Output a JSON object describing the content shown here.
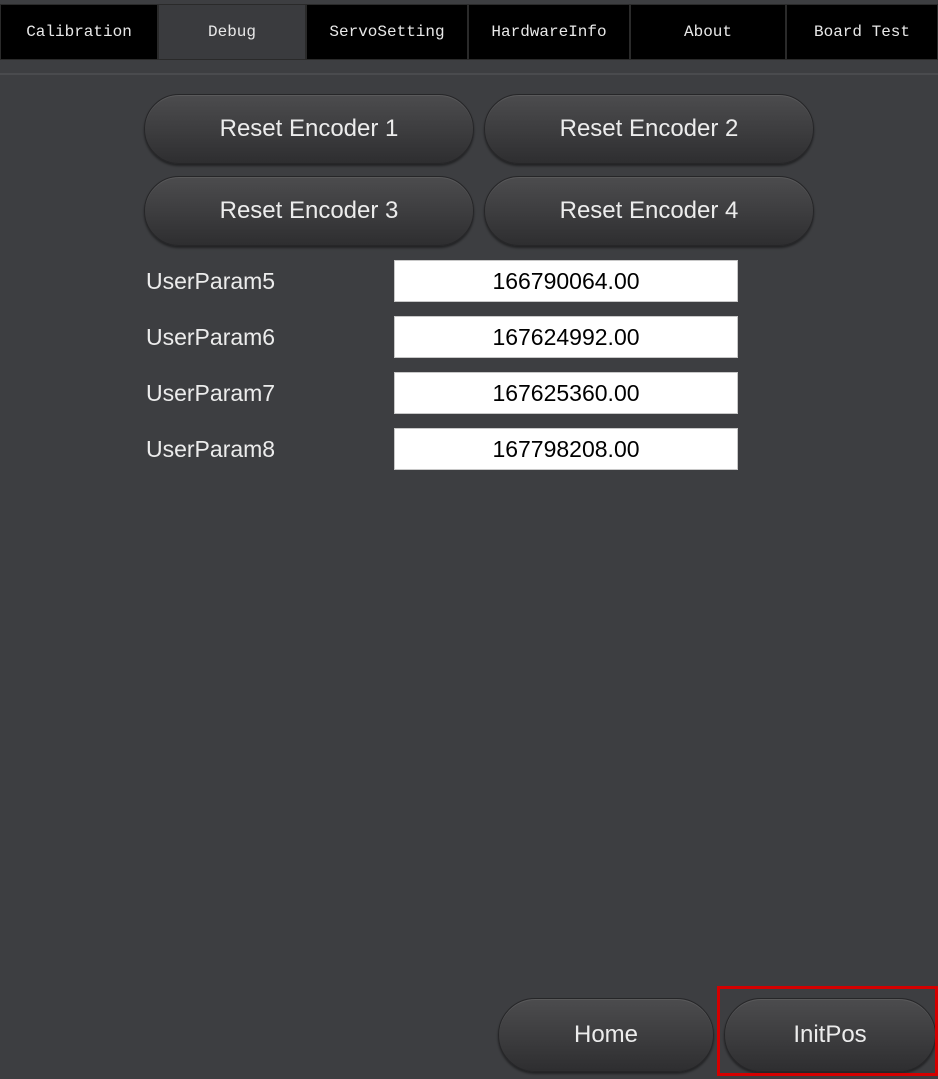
{
  "tabs": [
    {
      "label": "Calibration",
      "active": false
    },
    {
      "label": "Debug",
      "active": true
    },
    {
      "label": "ServoSetting",
      "active": false
    },
    {
      "label": "HardwareInfo",
      "active": false
    },
    {
      "label": "About",
      "active": false
    },
    {
      "label": "Board Test",
      "active": false
    }
  ],
  "encoders": {
    "reset1": "Reset Encoder 1",
    "reset2": "Reset Encoder 2",
    "reset3": "Reset Encoder 3",
    "reset4": "Reset Encoder 4"
  },
  "params": [
    {
      "label": "UserParam5",
      "value": "166790064.00"
    },
    {
      "label": "UserParam6",
      "value": "167624992.00"
    },
    {
      "label": "UserParam7",
      "value": "167625360.00"
    },
    {
      "label": "UserParam8",
      "value": "167798208.00"
    }
  ],
  "footer": {
    "home_label": "Home",
    "initpos_label": "InitPos"
  },
  "colors": {
    "background": "#3d3e41",
    "tab_background": "#000000",
    "highlight": "#d40000"
  }
}
